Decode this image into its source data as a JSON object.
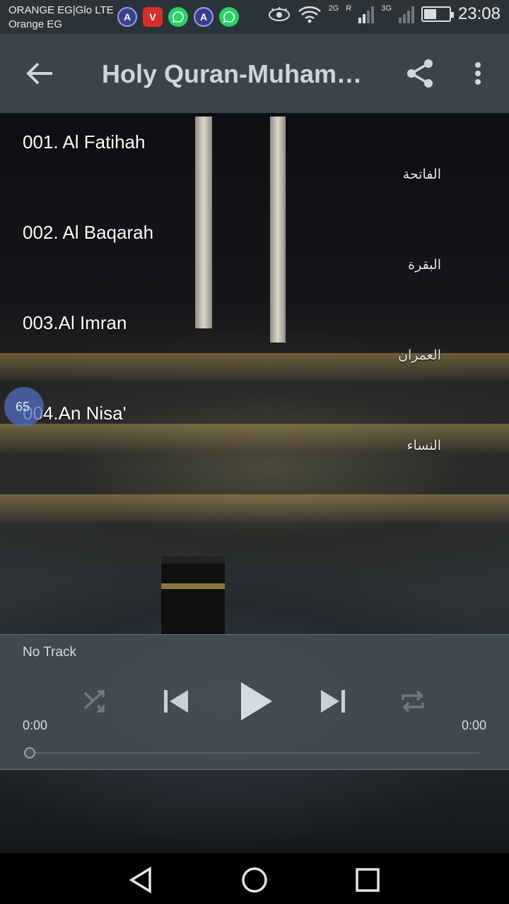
{
  "status_bar": {
    "carrier_line1": "ORANGE EG|Glo LTE",
    "carrier_line2": "Orange EG",
    "notifications": [
      "app-a-icon",
      "vivaldi-icon",
      "whatsapp-icon",
      "app-a-icon",
      "whatsapp-icon"
    ],
    "network_2g": "2G",
    "network_r": "R",
    "network_3g": "3G",
    "time": "23:08",
    "battery_level": 0.5
  },
  "app_bar": {
    "title": "Holy Quran-Muhammad Al Luhaidan"
  },
  "tracks": [
    {
      "title": "001. Al Fatihah",
      "arabic": "الفاتحة"
    },
    {
      "title": "002. Al Baqarah",
      "arabic": "البقرة"
    },
    {
      "title": "003.Al Imran",
      "arabic": "العمران"
    },
    {
      "title": "004.An Nisa'",
      "arabic": "النساء"
    }
  ],
  "floating_badge": "65",
  "player": {
    "track_name": "No Track",
    "current_time": "0:00",
    "total_time": "0:00",
    "progress": 0
  },
  "colors": {
    "status_bar": "#2c3338",
    "app_bar": "#3a444a",
    "player_bg": "#46505a"
  }
}
